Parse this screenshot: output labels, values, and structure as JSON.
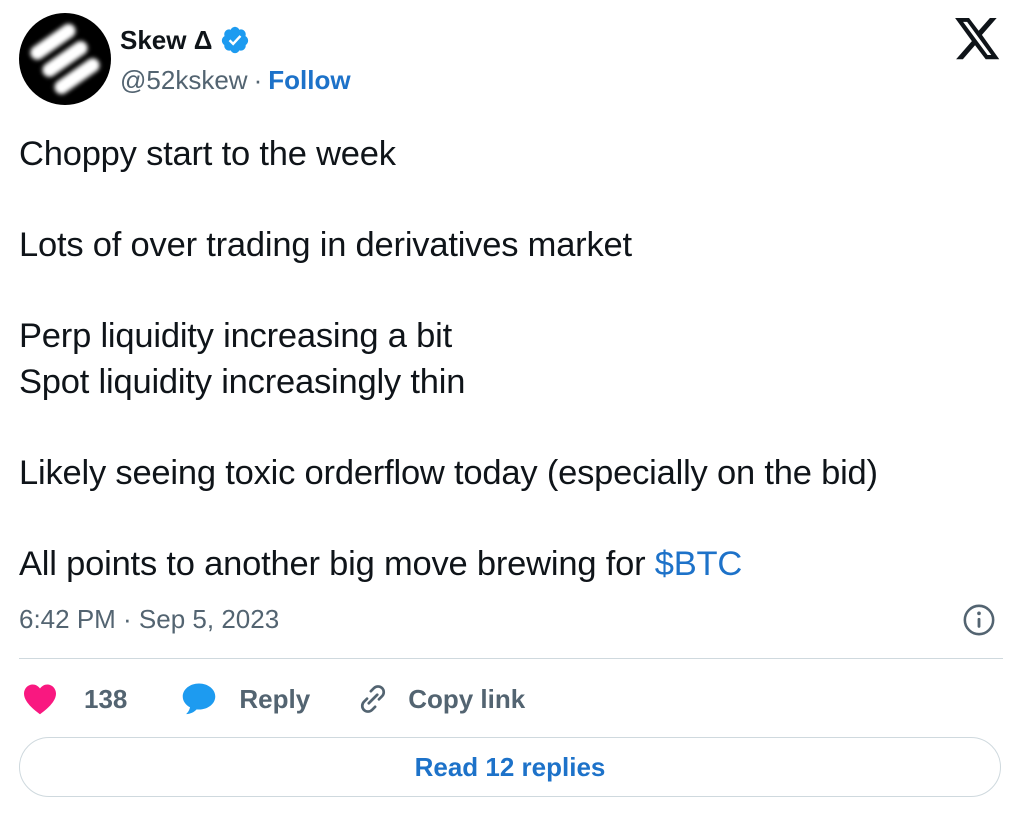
{
  "author": {
    "display_name": "Skew Δ",
    "handle": "@52kskew",
    "separator": "·",
    "follow_label": "Follow",
    "verified_color": "#1d9bf0"
  },
  "tweet": {
    "body": "Choppy start to the week\n\nLots of over trading in derivatives market\n\nPerp liquidity increasing a bit\nSpot liquidity increasingly thin\n\nLikely seeing toxic orderflow today (especially on the bid)\n\nAll points to another big move brewing for ",
    "cashtag": "$BTC",
    "timestamp": "6:42 PM · Sep 5, 2023"
  },
  "actions": {
    "like_count": "138",
    "reply_label": "Reply",
    "copy_link_label": "Copy link"
  },
  "read_replies_label": "Read 12 replies",
  "colors": {
    "link": "#1d72c9",
    "heart": "#f91880",
    "reply_bubble": "#1d9bf0",
    "muted": "#536471"
  },
  "icons": [
    "avatar-logo",
    "verified-badge-icon",
    "x-logo-icon",
    "info-icon",
    "heart-icon",
    "reply-bubble-icon",
    "link-icon"
  ]
}
